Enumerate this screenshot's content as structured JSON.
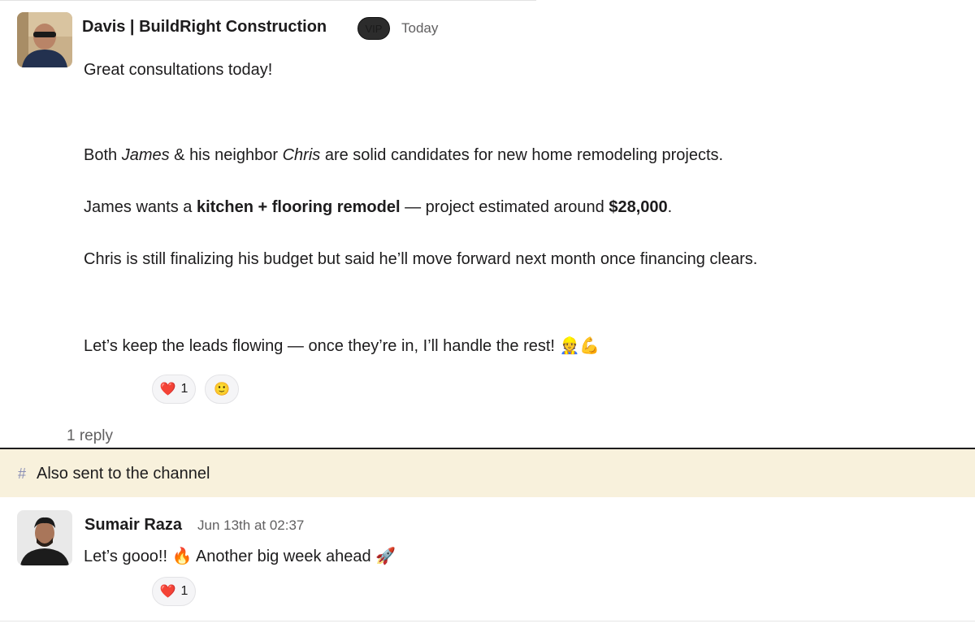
{
  "message1": {
    "author": "Davis | BuildRight Construction",
    "badge": "VIP",
    "timestamp": "Today",
    "line1": "Great consultations today!",
    "line2": {
      "t1": "Both ",
      "name1": "James",
      "t2": " & his neighbor ",
      "name2": "Chris",
      "t3": " are solid candidates for new home remodeling projects."
    },
    "line3": {
      "t1": "James wants a ",
      "bold1": "kitchen + flooring remodel",
      "t2": " — project estimated around ",
      "bold2": "$28,000",
      "t3": "."
    },
    "line4": "Chris is still finalizing his budget but said he’ll move forward next month once financing clears.",
    "line5": "Let’s keep the leads flowing — once they’re in, I’ll handle the rest! 👷💪",
    "reactions": [
      {
        "emoji": "❤️",
        "count": "1"
      },
      {
        "emoji": "🙂",
        "count": ""
      }
    ],
    "reply_count": "1 reply"
  },
  "channel_bar": {
    "icon": "#",
    "text": "Also sent to the channel"
  },
  "message2": {
    "author": "Sumair Raza",
    "timestamp": "Jun 13th at 02:37",
    "text": "Let’s gooo!! 🔥 Another big week ahead 🚀",
    "reactions": [
      {
        "emoji": "❤️",
        "count": "1"
      }
    ]
  }
}
